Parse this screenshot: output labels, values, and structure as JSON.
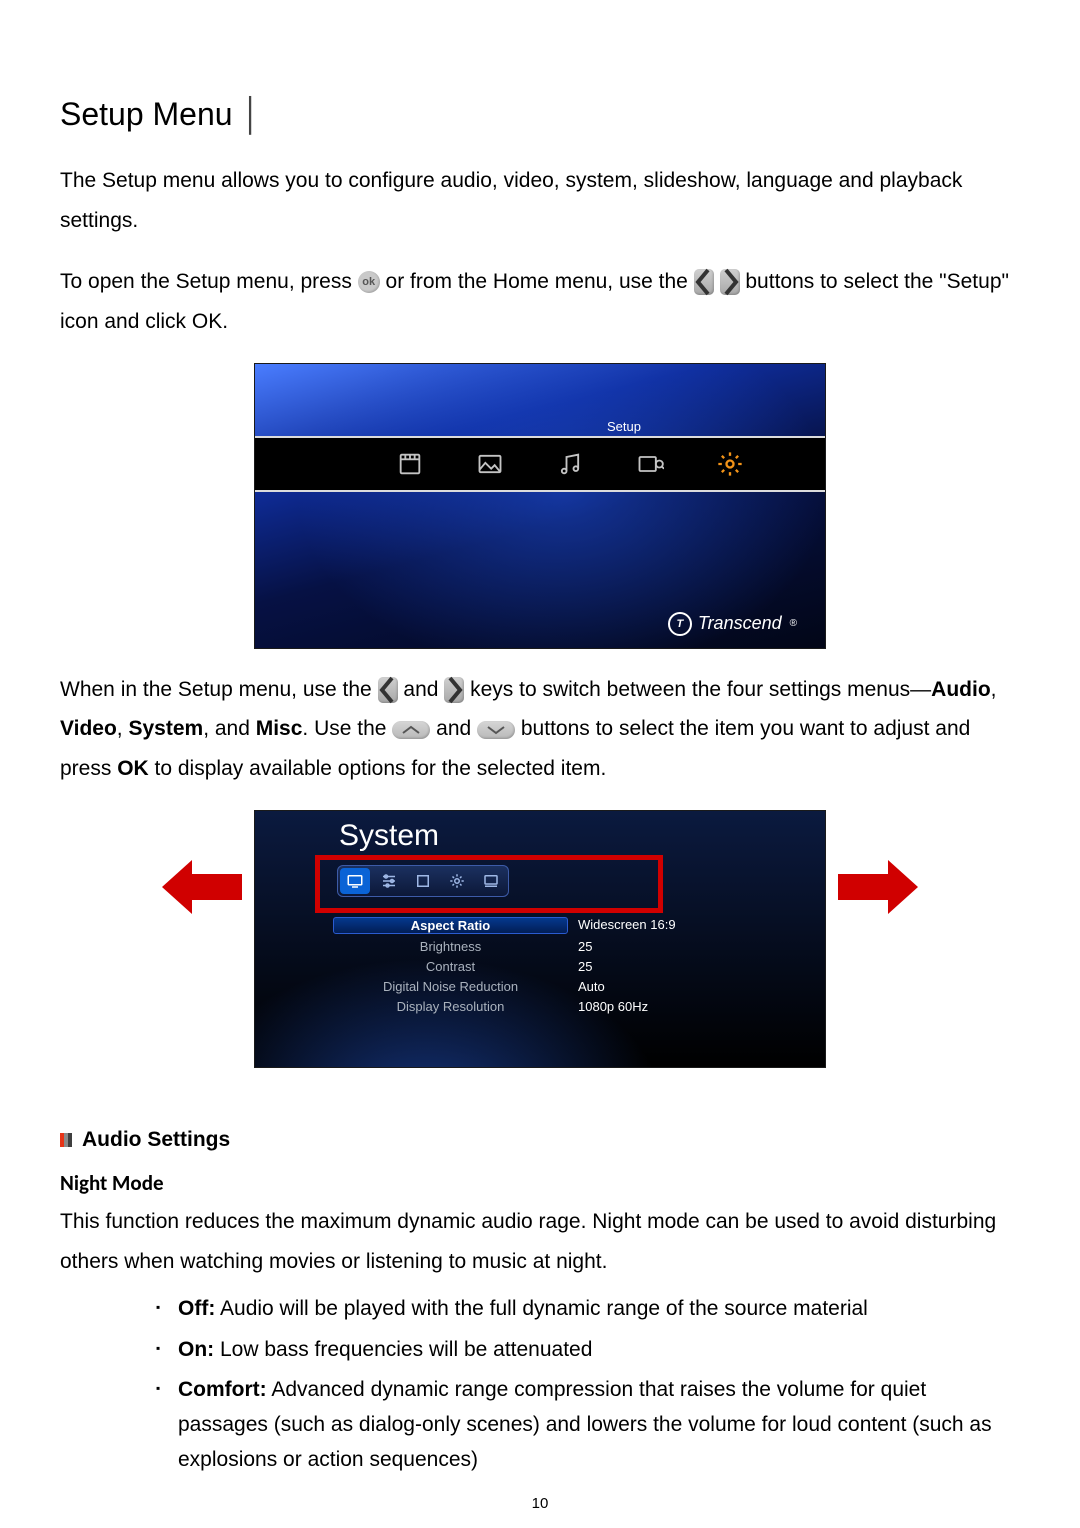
{
  "title": "Setup Menu",
  "title_pipe": "│",
  "intro": {
    "p1_a": "The Setup menu allows you to configure audio, video, system, slideshow, language and playback settings.",
    "p2_a": "To open the Setup menu, press ",
    "p2_b": " or from the Home menu, use the ",
    "p2_c": " buttons to select the \"Setup\" icon and click OK."
  },
  "okglyph": "ok",
  "shot1": {
    "label": "Setup",
    "brand": "Transcend",
    "reg": "®"
  },
  "mid": {
    "a": "When in the Setup menu, use the ",
    "b": " and ",
    "c": " keys to switch between the four settings menus—",
    "audio": "Audio",
    "d": ", ",
    "video": "Video",
    "e": ", ",
    "system": "System",
    "f": ", and ",
    "misc": "Misc",
    "g": ". Use the ",
    "h": " and ",
    "i": " buttons to select the item you want to adjust and press ",
    "ok": "OK",
    "j": " to display available options for the selected item."
  },
  "shot2": {
    "title": "System",
    "rows": [
      {
        "k": "Aspect Ratio",
        "v": "Widescreen 16:9",
        "sel": true
      },
      {
        "k": "Brightness",
        "v": "25"
      },
      {
        "k": "Contrast",
        "v": "25"
      },
      {
        "k": "Digital Noise Reduction",
        "v": "Auto"
      },
      {
        "k": "Display Resolution",
        "v": "1080p 60Hz"
      }
    ]
  },
  "sect_title": "Audio Settings",
  "night": {
    "head": "Night Mode",
    "desc": "This function reduces the maximum dynamic audio rage. Night mode can be used to avoid disturbing others when watching movies or listening to music at night.",
    "opts": [
      {
        "b": "Off:",
        "t": " Audio will be played with the full dynamic range of the source material"
      },
      {
        "b": "On:",
        "t": " Low bass frequencies will be attenuated"
      },
      {
        "b": "Comfort:",
        "t": " Advanced dynamic range compression that raises the volume for quiet passages (such as dialog-only scenes) and lowers the volume for loud content (such as explosions or action sequences)"
      }
    ]
  },
  "page_number": "10"
}
